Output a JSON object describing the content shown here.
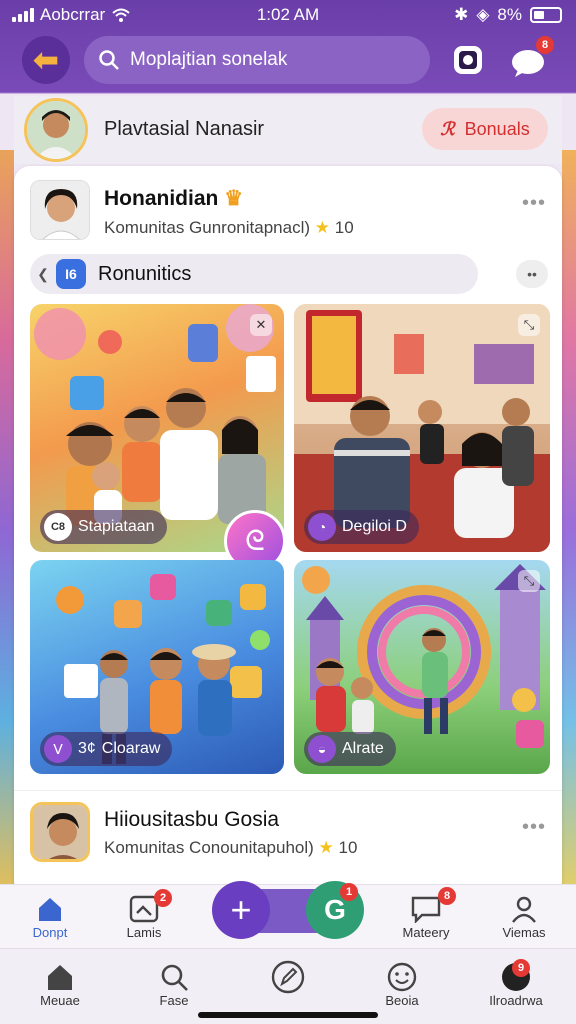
{
  "status_bar": {
    "carrier": "Aobcrrar",
    "time": "1:02 AM",
    "battery": "8%"
  },
  "search": {
    "placeholder": "Moplajtian sonelak"
  },
  "header": {
    "message_badge": "8"
  },
  "user_bar": {
    "name": "Plavtasial Nanasir",
    "bonus_label": "Bonuals"
  },
  "post1": {
    "title": "Honanidian",
    "subtitle": "Komunitas  Gunronitapnacl)",
    "count": "10"
  },
  "community": {
    "badge": "I6",
    "label": "Ronunitics"
  },
  "tiles": [
    {
      "tag": "Stapiataan",
      "tag_icon": "C8"
    },
    {
      "tag": "Degiloi D",
      "tag_icon": ""
    },
    {
      "tag": "Cloaraw",
      "tag_icon": "3¢"
    },
    {
      "tag": "Alrate",
      "tag_icon": ""
    }
  ],
  "post2": {
    "title": "Hiiousitasbu Gosia",
    "subtitle": "Komunitas  Conounitapuhol)",
    "count": "10"
  },
  "nav_top": [
    {
      "label": "Donpt",
      "badge": ""
    },
    {
      "label": "Lamis",
      "badge": "2"
    },
    {
      "label": "",
      "badge": ""
    },
    {
      "label": "",
      "badge": "1"
    },
    {
      "label": "Mateery",
      "badge": "8"
    },
    {
      "label": "Viemas",
      "badge": ""
    }
  ],
  "nav_bottom": [
    {
      "label": "Meuae"
    },
    {
      "label": "Fase"
    },
    {
      "label": ""
    },
    {
      "label": "Beoia"
    },
    {
      "label": "Ilroadrwa",
      "badge": "9"
    }
  ],
  "colors": {
    "accent": "#6a3ec0",
    "bonus": "#d32f2f",
    "green": "#2f9e75"
  }
}
